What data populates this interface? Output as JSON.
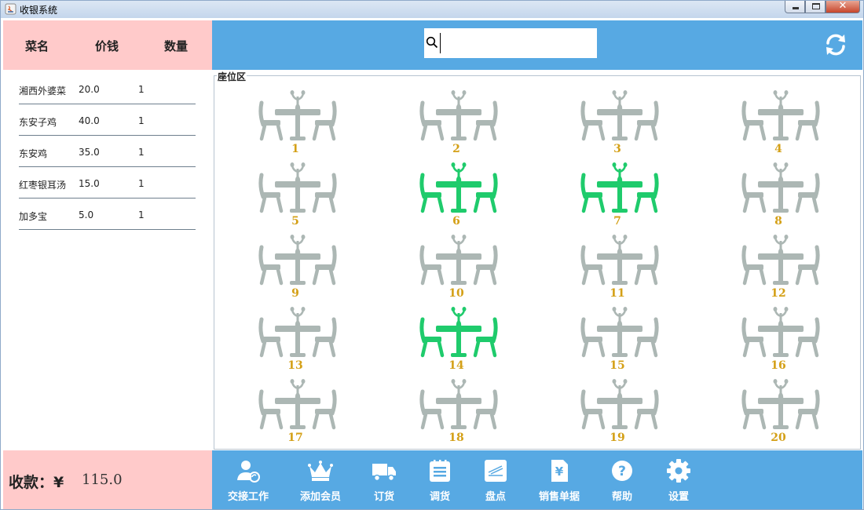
{
  "window": {
    "title": "收银系统"
  },
  "order": {
    "headers": {
      "name": "菜名",
      "price": "价钱",
      "qty": "数量"
    },
    "rows": [
      {
        "name": "湘西外婆菜",
        "price": "20.0",
        "qty": "1"
      },
      {
        "name": "东安子鸡",
        "price": "40.0",
        "qty": "1"
      },
      {
        "name": "东安鸡",
        "price": "35.0",
        "qty": "1"
      },
      {
        "name": "红枣银耳汤",
        "price": "15.0",
        "qty": "1"
      },
      {
        "name": "加多宝",
        "price": "5.0",
        "qty": "1"
      }
    ],
    "total_label": "收款：¥",
    "total_value": "115.0"
  },
  "search": {
    "value": "",
    "placeholder": ""
  },
  "seat_area": {
    "title": "座位区",
    "free_color": "#acb7b4",
    "occupied_color": "#1fcb6c",
    "tables": [
      {
        "number": "1",
        "occupied": false
      },
      {
        "number": "2",
        "occupied": false
      },
      {
        "number": "3",
        "occupied": false
      },
      {
        "number": "4",
        "occupied": false
      },
      {
        "number": "5",
        "occupied": false
      },
      {
        "number": "6",
        "occupied": true
      },
      {
        "number": "7",
        "occupied": true
      },
      {
        "number": "8",
        "occupied": false
      },
      {
        "number": "9",
        "occupied": false
      },
      {
        "number": "10",
        "occupied": false
      },
      {
        "number": "11",
        "occupied": false
      },
      {
        "number": "12",
        "occupied": false
      },
      {
        "number": "13",
        "occupied": false
      },
      {
        "number": "14",
        "occupied": true
      },
      {
        "number": "15",
        "occupied": false
      },
      {
        "number": "16",
        "occupied": false
      },
      {
        "number": "17",
        "occupied": false
      },
      {
        "number": "18",
        "occupied": false
      },
      {
        "number": "19",
        "occupied": false
      },
      {
        "number": "20",
        "occupied": false
      }
    ]
  },
  "toolbar": {
    "items": [
      {
        "label": "交接工作",
        "icon": "user-handover-icon"
      },
      {
        "label": "添加会员",
        "icon": "crown-icon"
      },
      {
        "label": "订货",
        "icon": "truck-icon"
      },
      {
        "label": "调货",
        "icon": "notepad-icon"
      },
      {
        "label": "盘点",
        "icon": "inventory-icon"
      },
      {
        "label": "销售单据",
        "icon": "yen-document-icon"
      },
      {
        "label": "帮助",
        "icon": "help-icon"
      },
      {
        "label": "设置",
        "icon": "gear-icon"
      }
    ]
  },
  "colors": {
    "brand_blue": "#57a9e3",
    "pink": "#ffcaca",
    "table_number": "#d4a017"
  }
}
